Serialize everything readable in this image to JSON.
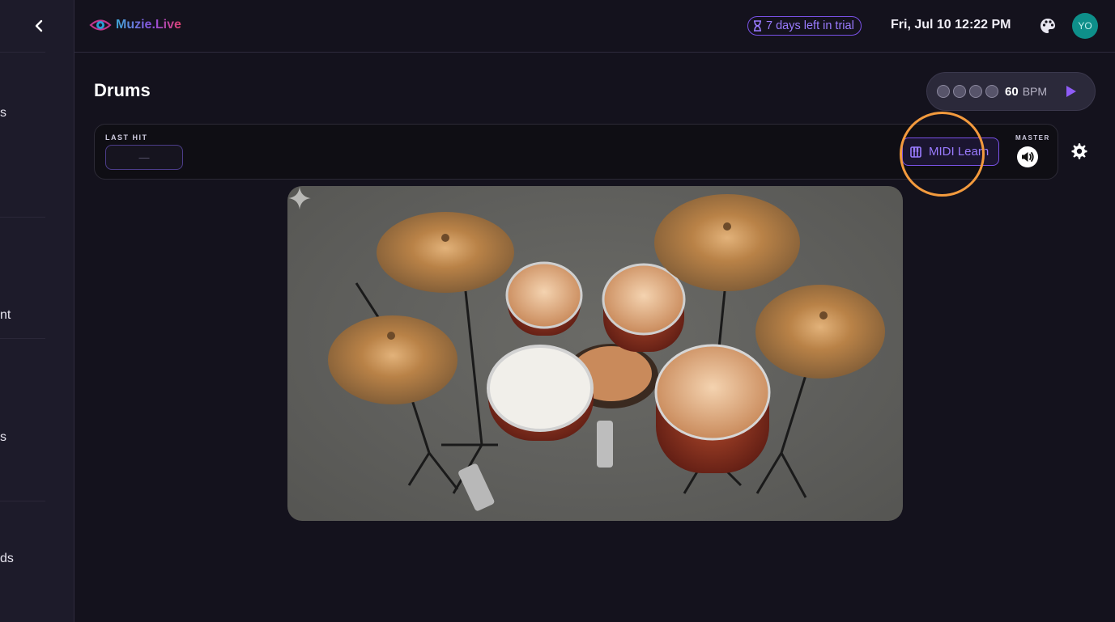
{
  "sidebar": {
    "fragments": [
      "s",
      "nt",
      "s",
      "ds"
    ]
  },
  "header": {
    "logo_text": "Muzie.Live",
    "trial_text": "7 days left in trial",
    "datetime": "Fri, Jul 10 12:22 PM",
    "avatar_initials": "YO"
  },
  "main": {
    "title": "Drums",
    "metronome": {
      "bpm": "60",
      "unit": "BPM",
      "beats": 4
    },
    "control_bar": {
      "last_hit_label": "LAST HIT",
      "last_hit_value": "—",
      "midi_learn_label": "MIDI Learn",
      "master_label": "MASTER"
    }
  },
  "colors": {
    "accent": "#7a52e8",
    "highlight": "#f39a3d",
    "avatar": "#0e8f8a",
    "background": "#14121d"
  },
  "icons": [
    "chevron-left-icon",
    "eye-logo-icon",
    "hourglass-icon",
    "palette-icon",
    "play-icon",
    "piano-icon",
    "volume-icon",
    "gear-icon",
    "sparkle-icon"
  ]
}
